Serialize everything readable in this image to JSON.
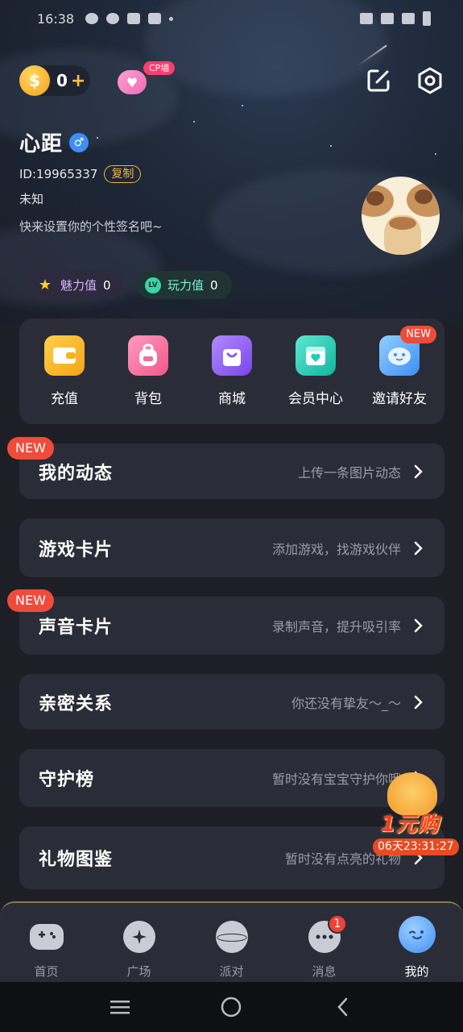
{
  "status_bar": {
    "time": "16:38"
  },
  "header": {
    "coins": "0",
    "coin_plus": "+",
    "cp_tag": "CP墙"
  },
  "profile": {
    "name": "心距",
    "gender_symbol": "♂",
    "id_text": "ID:19965337",
    "copy_label": "复制",
    "region": "未知",
    "signature": "快来设置你的个性签名吧~"
  },
  "stats": {
    "charm_label": "魅力值",
    "charm_value": "0",
    "play_label": "玩力值",
    "play_value": "0",
    "play_icon_text": "LV"
  },
  "quick_actions": [
    {
      "label": "充值",
      "icon": "wallet-icon",
      "color": "#f7b21c"
    },
    {
      "label": "背包",
      "icon": "backpack-icon",
      "color": "#f36c9a"
    },
    {
      "label": "商城",
      "icon": "shopping-bag-icon",
      "color": "#8f5cf1"
    },
    {
      "label": "会员中心",
      "icon": "member-heart-icon",
      "color": "#23cbb4"
    },
    {
      "label": "邀请好友",
      "icon": "invite-face-icon",
      "color": "#4ea6f3",
      "badge": "NEW"
    }
  ],
  "menu": [
    {
      "title": "我的动态",
      "desc": "上传一条图片动态",
      "badge": "NEW"
    },
    {
      "title": "游戏卡片",
      "desc": "添加游戏，找游戏伙伴"
    },
    {
      "title": "声音卡片",
      "desc": "录制声音，提升吸引率",
      "badge": "NEW"
    },
    {
      "title": "亲密关系",
      "desc": "你还没有挚友～_～"
    },
    {
      "title": "守护榜",
      "desc": "暂时没有宝宝守护你哦"
    },
    {
      "title": "礼物图鉴",
      "desc": "暂时没有点亮的礼物"
    }
  ],
  "promo": {
    "text": "1元购",
    "timer": "06天23:31:27"
  },
  "tabbar": [
    {
      "label": "首页",
      "icon": "gamepad-icon"
    },
    {
      "label": "广场",
      "icon": "sparkle-icon"
    },
    {
      "label": "派对",
      "icon": "planet-icon"
    },
    {
      "label": "消息",
      "icon": "chat-bubble-icon",
      "badge": "1"
    },
    {
      "label": "我的",
      "icon": "me-face-icon",
      "active": true
    }
  ]
}
